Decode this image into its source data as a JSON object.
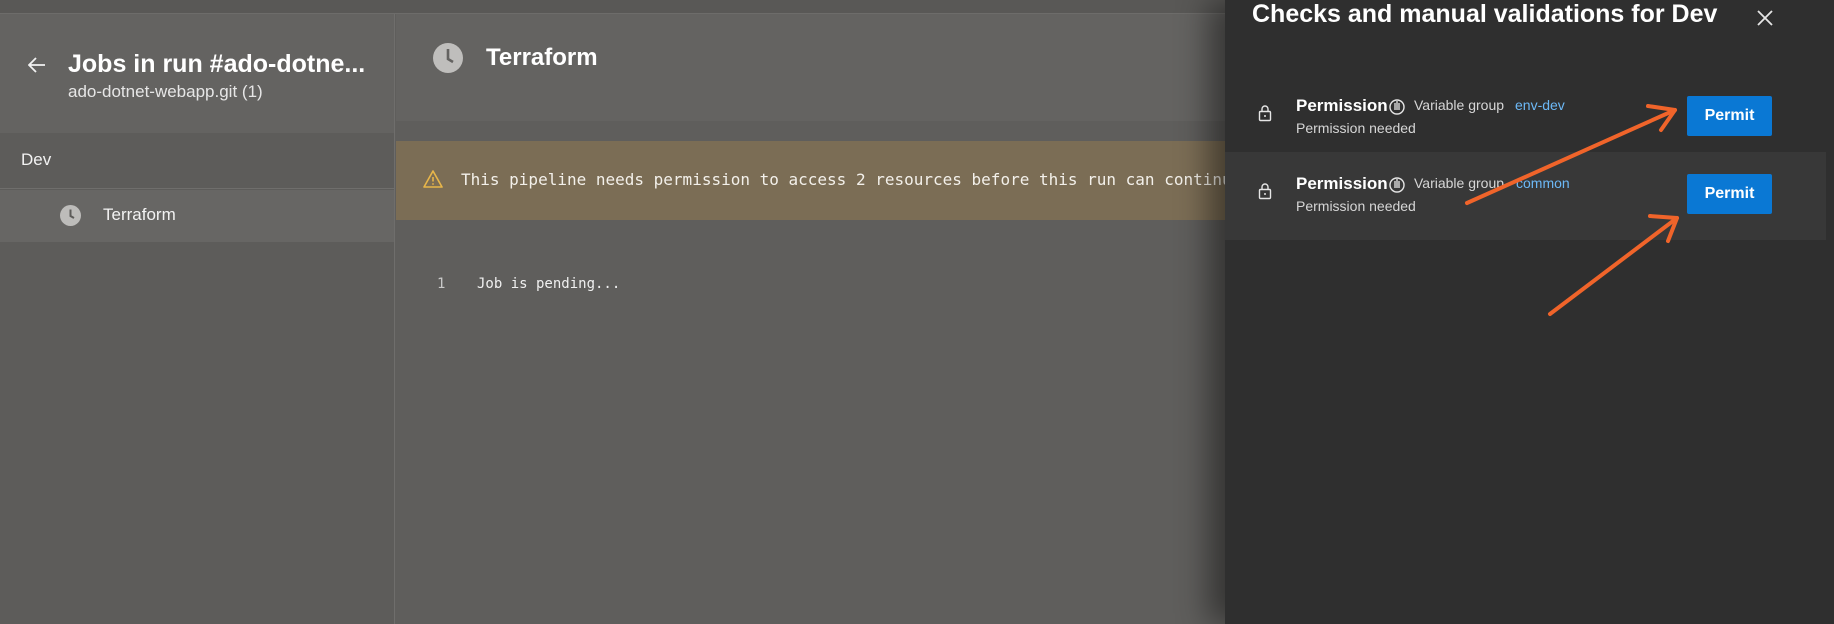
{
  "left_panel": {
    "title": "Jobs in run #ado-dotne...",
    "subtitle": "ado-dotnet-webapp.git (1)",
    "stage": "Dev",
    "job": "Terraform"
  },
  "main": {
    "title": "Terraform",
    "warning": "This pipeline needs permission to access 2 resources before this run can continu",
    "log": [
      {
        "line": "1",
        "text": "Job is pending..."
      }
    ]
  },
  "side_panel": {
    "title": "Checks and manual validations for Dev",
    "checks": [
      {
        "name": "Permission",
        "type": "Variable group",
        "resource": "env-dev",
        "status": "Permission needed",
        "button": "Permit"
      },
      {
        "name": "Permission",
        "type": "Variable group",
        "resource": "common",
        "status": "Permission needed",
        "button": "Permit"
      }
    ]
  },
  "colors": {
    "primary_button": "#0a78d4",
    "link": "#6cb8f6",
    "warning_banner": "#7b6d55",
    "annotation_arrow": "#f0642a"
  },
  "icons": [
    "back-arrow-icon",
    "clock-icon",
    "warning-icon",
    "close-icon",
    "lock-icon",
    "approval-hand-icon"
  ]
}
